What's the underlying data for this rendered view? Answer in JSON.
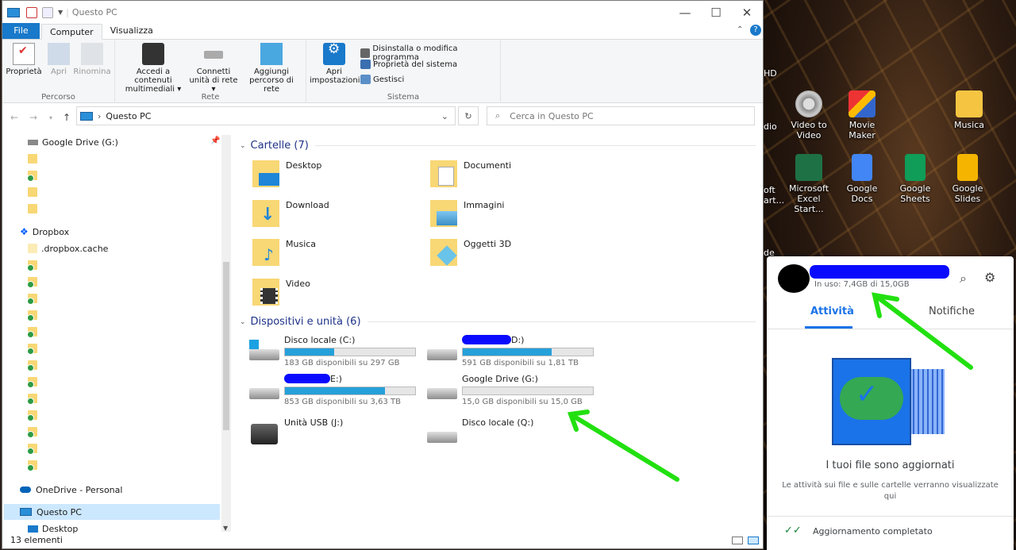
{
  "window": {
    "title": "Questo PC",
    "close": "✕",
    "maximize": "☐",
    "minimize": "—"
  },
  "tabs": [
    {
      "label": "File"
    },
    {
      "label": "Computer"
    },
    {
      "label": "Visualizza"
    }
  ],
  "ribbon": {
    "percorso": {
      "label": "Percorso",
      "properties": "Proprietà",
      "open": "Apri",
      "rename": "Rinomina"
    },
    "rete": {
      "label": "Rete",
      "media_1": "Accedi a contenuti",
      "media_2": "multimediali",
      "map_1": "Connetti",
      "map_2": "unità di rete",
      "add_1": "Aggiungi",
      "add_2": "percorso di rete"
    },
    "sistema": {
      "label": "Sistema",
      "settings_1": "Apri",
      "settings_2": "impostazioni",
      "uninstall": "Disinstalla o modifica programma",
      "sysprops": "Proprietà del sistema",
      "manage": "Gestisci"
    }
  },
  "address": {
    "path": "Questo PC",
    "search_placeholder": "Cerca in Questo PC"
  },
  "nav": {
    "google_drive": "Google Drive (G:)",
    "dropbox": "Dropbox",
    "dropbox_cache": ".dropbox.cache",
    "onedrive": "OneDrive - Personal",
    "this_pc": "Questo PC",
    "desktop": "Desktop"
  },
  "folders": {
    "header": "Cartelle (7)",
    "items": [
      "Desktop",
      "Documenti",
      "Download",
      "Immagini",
      "Musica",
      "Oggetti 3D",
      "Video"
    ]
  },
  "devices": {
    "header": "Dispositivi e unità (6)",
    "items": [
      {
        "name": "Disco locale (C:)",
        "free": "183 GB disponibili su 297 GB",
        "used": 0.38
      },
      {
        "name": "D:)",
        "free": "591 GB disponibili su 1,81 TB",
        "used": 0.68
      },
      {
        "name": "E:)",
        "free": "853 GB disponibili su 3,63 TB",
        "used": 0.77
      },
      {
        "name": "Google Drive (G:)",
        "free": "15,0 GB disponibili su 15,0 GB",
        "used": 0.0
      },
      {
        "name": "Unità USB (J:)"
      },
      {
        "name": "Disco locale (Q:)"
      }
    ]
  },
  "status": {
    "count": "13 elementi"
  },
  "desktop": {
    "icons": [
      "Video to Video",
      "Movie Maker",
      "Musica",
      "Microsoft Excel Start...",
      "Google Docs",
      "Google Sheets",
      "Google Slides"
    ],
    "clip_hd": "HD",
    "clip_audio": "dio",
    "clip_oft": "oft",
    "clip_art": "art...",
    "clip_de": "de"
  },
  "drive_panel": {
    "usage": "In uso: 7,4GB di 15,0GB",
    "tab_activity": "Attività",
    "tab_notifications": "Notifiche",
    "message_title": "I tuoi file sono aggiornati",
    "message_body": "Le attività sui file e sulle cartelle verranno visualizzate qui",
    "footer": "Aggiornamento completato"
  },
  "colors": {
    "accent": "#1979ca",
    "bar": "#26a0da",
    "redact": "#0a0aff",
    "arrow": "#22e010",
    "drive_blue": "#1a73e8"
  }
}
